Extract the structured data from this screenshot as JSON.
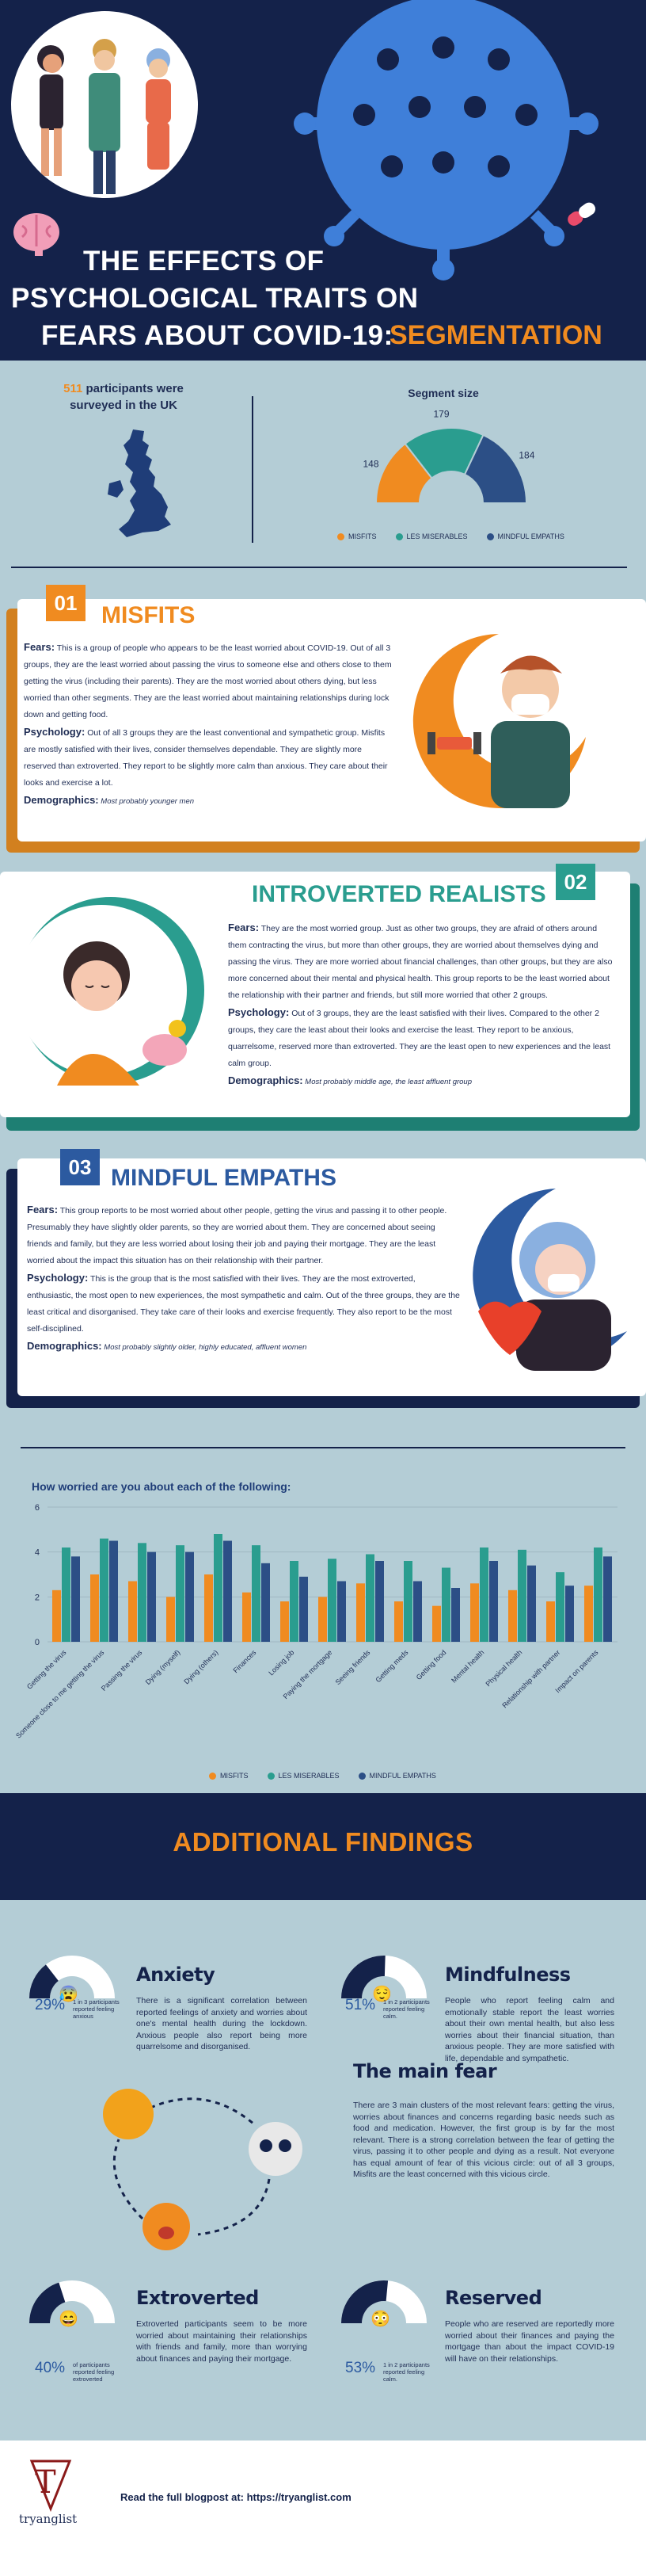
{
  "header": {
    "title_line1": "THE EFFECTS OF",
    "title_line2": "PSYCHOLOGICAL TRAITS ON",
    "title_line3": "FEARS ABOUT COVID-19:",
    "title_highlight": "SEGMENTATION"
  },
  "stats": {
    "participants_number": "511",
    "participants_text": " participants were",
    "participants_text2": "surveyed in the UK",
    "segment_size_title": "Segment size"
  },
  "legend": {
    "misfits": "MISFITS",
    "realists": "LES MISERABLES",
    "empaths": "MINDFUL EMPATHS"
  },
  "colors": {
    "misfits": "#f08b20",
    "realists": "#2a9d8f",
    "empaths": "#2c4f86",
    "navy": "#14224a"
  },
  "misfits": {
    "number": "01",
    "title": "MISFITS",
    "fears_label": "Fears:",
    "fears_text": " This is a group of people who appears to be the least worried about COVID-19. Out of all 3 groups, they are the least worried about passing the virus to someone else and others close to them getting the virus (including their parents). They are the most worried about others dying, but less worried than other segments. They are the least worried about maintaining relationships during lock down and getting food.",
    "psych_label": "Psychology:",
    "psych_text": " Out of all 3 groups they are the least conventional and sympathetic group. Misfits are mostly satisfied with their lives, consider themselves dependable. They are slightly more reserved than extroverted. They report to be slightly more calm than anxious. They care about their looks and exercise a lot.",
    "demo_label": "Demographics:",
    "demo_text": " Most probably younger men"
  },
  "realists": {
    "number": "02",
    "title": "INTROVERTED REALISTS",
    "fears_label": "Fears:",
    "fears_text": " They are the most worried group. Just as other two groups, they are afraid of others around them contracting the virus, but more than other groups, they are worried about themselves dying and passing the virus. They are more worried about financial challenges, than other groups, but they are also more concerned about their mental and physical health. This group reports to be the least worried about the relationship with their partner and friends, but still more worried that other 2 groups.",
    "psych_label": "Psychology:",
    "psych_text": " Out of 3 groups, they are the least satisfied with their lives. Compared to the other 2 groups, they care the least about their looks and exercise the least. They report to be anxious, quarrelsome, reserved more than extroverted. They are the least open to new experiences and the least calm group.",
    "demo_label": "Demographics:",
    "demo_text": " Most probably middle age, the least affluent group"
  },
  "empaths": {
    "number": "03",
    "title": "MINDFUL EMPATHS",
    "fears_label": "Fears:",
    "fears_text": " This group reports to be most worried about other people, getting the virus and passing it to other people. Presumably they have slightly older parents, so they are worried about them. They are concerned about seeing friends and family, but they are less worried about losing their job and paying their mortgage. They are the least worried about the impact this situation has on their relationship with their partner.",
    "psych_label": "Psychology:",
    "psych_text": " This is the group that is the most satisfied with their lives. They are the most extroverted, enthusiastic, the most open to new experiences, the most sympathetic and calm. Out of the three groups, they are the least critical and disorganised. They take care of their looks and exercise frequently. They also report to be the most self-disciplined.",
    "demo_label": "Demographics:",
    "demo_text": " Most probably slightly older, highly educated, affluent women"
  },
  "chart_data": [
    {
      "type": "pie",
      "title": "Segment size",
      "categories": [
        "MISFITS",
        "LES MISERABLES",
        "MINDFUL EMPATHS"
      ],
      "values": [
        148,
        179,
        184
      ]
    },
    {
      "type": "bar",
      "title": "How worried are you about each of the following:",
      "categories": [
        "Getting the virus",
        "Someone close to me getting the virus",
        "Passing the virus",
        "Dying (myself)",
        "Dying (others)",
        "Finances",
        "Losing job",
        "Paying the mortgage",
        "Seeing friends",
        "Getting meds",
        "Getting food",
        "Mental health",
        "Physical health",
        "Relationship with partner",
        "Impact on parents"
      ],
      "series": [
        {
          "name": "MISFITS",
          "values": [
            2.3,
            3.0,
            2.7,
            2.0,
            3.0,
            2.2,
            1.8,
            2.0,
            2.6,
            1.8,
            1.6,
            2.6,
            2.3,
            1.8,
            2.5
          ]
        },
        {
          "name": "LES MISERABLES",
          "values": [
            4.2,
            4.6,
            4.4,
            4.3,
            4.8,
            4.3,
            3.6,
            3.7,
            3.9,
            3.6,
            3.3,
            4.2,
            4.1,
            3.1,
            4.2
          ]
        },
        {
          "name": "MINDFUL EMPATHS",
          "values": [
            3.8,
            4.5,
            4.0,
            4.0,
            4.5,
            3.5,
            2.9,
            2.7,
            3.6,
            2.7,
            2.4,
            3.6,
            3.4,
            2.5,
            3.8
          ]
        }
      ],
      "ylim": [
        0,
        6
      ],
      "yticks": [
        "0",
        "2",
        "4",
        "6"
      ],
      "grid": true,
      "legend_position": "bottom"
    }
  ],
  "findings": {
    "title": "ADDITIONAL FINDINGS",
    "anxiety": {
      "title": "Anxiety",
      "text": "There is a significant correlation between reported feelings of anxiety and worries about one's mental health during the lockdown. Anxious people also report being more quarrelsome and disorganised.",
      "pct": "29%",
      "note": "1 in 3 participants reported feeling anxious",
      "value": 0.29
    },
    "mindfulness": {
      "title": "Mindfulness",
      "text": "People who report feeling calm and emotionally stable report the least worries about their own mental health, but also less worries about their financial situation, than anxious people.  They are more satisfied with life, dependable and sympathetic.",
      "pct": "51%",
      "note": "1 in 2 participants reported feeling calm.",
      "value": 0.51
    },
    "main_fear": {
      "title": "The main fear",
      "text": "There are 3 main clusters of the most relevant fears: getting the virus, worries about finances and concerns regarding basic needs such as food and medication. However, the first group is by far the most relevant. There is a strong correlation between the fear of getting the virus, passing it to other people and dying as a result. Not everyone has equal amount of fear of this vicious circle: out of all 3 groups, Misfits are the least concerned with this vicious circle."
    },
    "extroverted": {
      "title": "Extroverted",
      "text": "Extroverted participants seem to be more worried about maintaining their relationships with friends and family, more than worrying about finances and paying their mortgage.",
      "pct": "40%",
      "note": "of participants reported feeling extroverted",
      "value": 0.4
    },
    "reserved": {
      "title": "Reserved",
      "text": "People who are reserved are reportedly more worried about their finances and paying the mortgage than about the impact COVID-19 will have on their relationships.",
      "pct": "53%",
      "note": "1 in 2 participants reported feeling calm.",
      "value": 0.53
    }
  },
  "footer": {
    "logo_letter": "T",
    "logo_text": "tryanglist",
    "cta": "Read the full blogpost at: https://tryanglist.com"
  }
}
